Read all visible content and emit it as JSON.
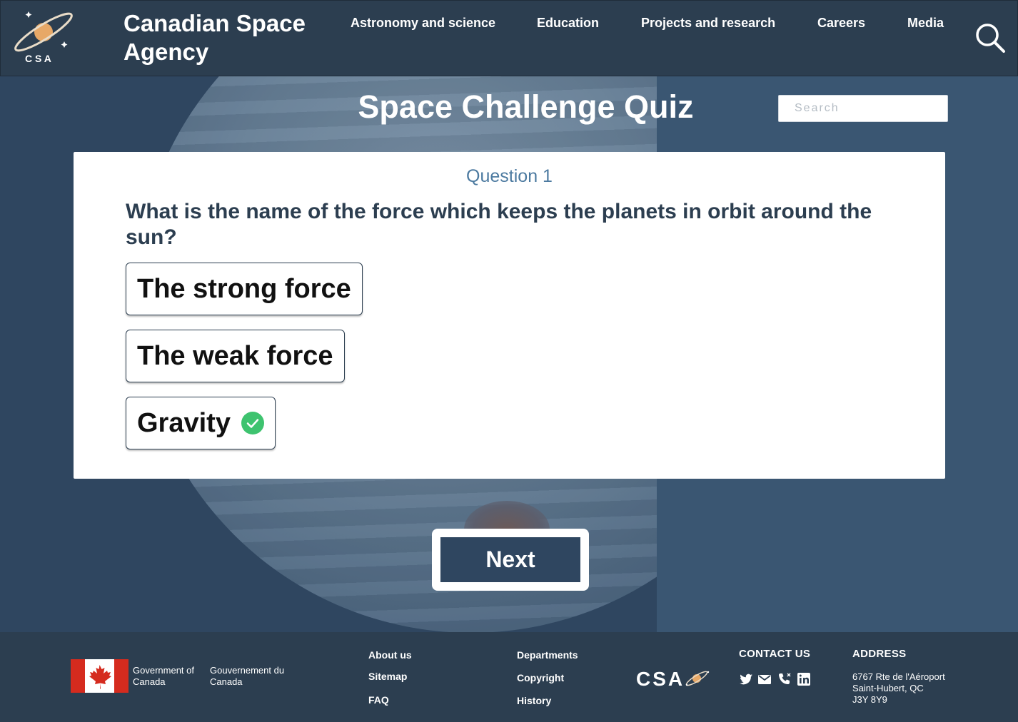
{
  "header": {
    "logo_text": "C S A",
    "brand_name": "Canadian Space Agency",
    "nav": [
      {
        "label": "Astronomy and science"
      },
      {
        "label": "Education"
      },
      {
        "label": "Projects and research"
      },
      {
        "label": "Careers"
      },
      {
        "label": "Media"
      }
    ],
    "search_icon": "search-icon"
  },
  "main": {
    "title": "Space Challenge Quiz",
    "search_placeholder": "Search",
    "question_label": "Question 1",
    "question_text": "What is the name of the force which keeps the planets in orbit around the sun?",
    "answers": [
      {
        "label": "The strong force",
        "correct": false
      },
      {
        "label": "The weak force",
        "correct": false
      },
      {
        "label": "Gravity",
        "correct": true
      }
    ],
    "next_label": "Next",
    "colors": {
      "correct": "#3ec36f",
      "header_bg": "#2c3e50",
      "accent_text": "#4c7aa0"
    }
  },
  "footer": {
    "gov_en": "Government of Canada",
    "gov_fr": "Gouvernement du Canada",
    "links_col1": [
      "About us",
      "Sitemap",
      "FAQ"
    ],
    "links_col2": [
      "Departments",
      "Copyright",
      "History"
    ],
    "csa_wordmark": "CSA",
    "contact_heading": "CONTACT US",
    "social_icons": [
      "twitter-icon",
      "mail-icon",
      "phone-icon",
      "linkedin-icon"
    ],
    "address_heading": "ADDRESS",
    "address_lines": [
      "6767 Rte de l'Aéroport",
      "Saint-Hubert, QC",
      "J3Y 8Y9"
    ]
  }
}
